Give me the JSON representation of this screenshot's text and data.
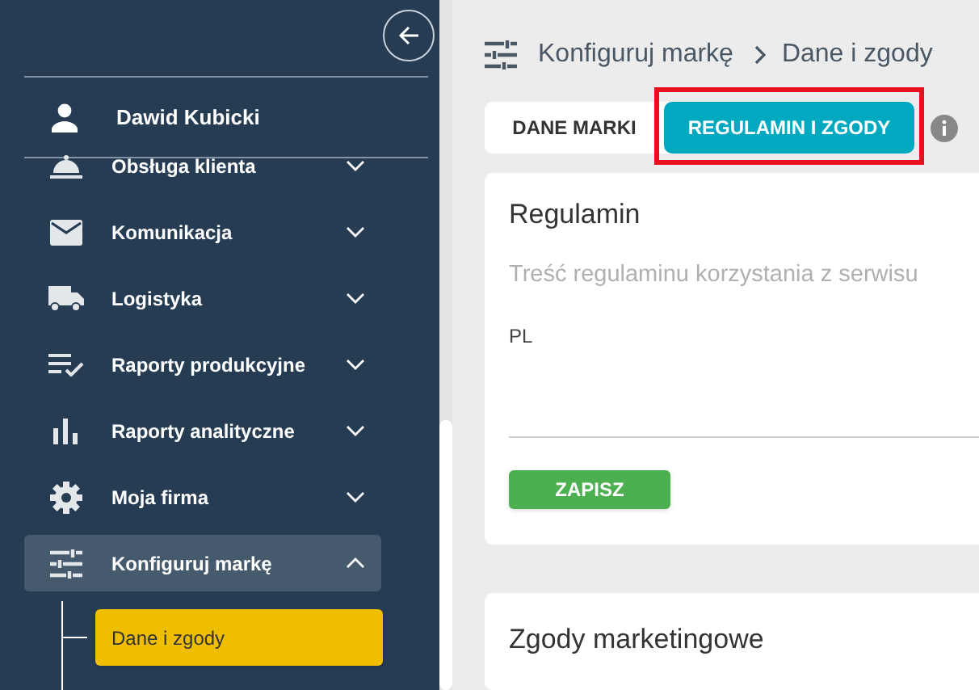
{
  "sidebar": {
    "user": {
      "name": "Dawid Kubicki"
    },
    "items": [
      {
        "kind": "bell",
        "label": "Obsługa klienta",
        "expanded": false,
        "selected": false
      },
      {
        "kind": "mail",
        "label": "Komunikacja",
        "expanded": false,
        "selected": false
      },
      {
        "kind": "truck",
        "label": "Logistyka",
        "expanded": false,
        "selected": false
      },
      {
        "kind": "checklist",
        "label": "Raporty produkcyjne",
        "expanded": false,
        "selected": false
      },
      {
        "kind": "bars",
        "label": "Raporty analityczne",
        "expanded": false,
        "selected": false
      },
      {
        "kind": "gear",
        "label": "Moja firma",
        "expanded": false,
        "selected": false
      },
      {
        "kind": "sliders",
        "label": "Konfiguruj markę",
        "expanded": true,
        "selected": true,
        "children": [
          {
            "label": "Dane i zgody",
            "selected": true
          }
        ]
      }
    ]
  },
  "breadcrumb": [
    "Konfiguruj markę",
    "Dane i zgody"
  ],
  "tabs": [
    {
      "label": "DANE MARKI",
      "selected": false,
      "highlighted": false
    },
    {
      "label": "REGULAMIN I ZGODY",
      "selected": true,
      "highlighted": true
    }
  ],
  "terms_card": {
    "title": "Regulamin",
    "placeholder": "Treść regulaminu korzystania z serwisu",
    "language": "PL",
    "button": "ZAPISZ"
  },
  "consents_card": {
    "title": "Zgody marketingowe"
  }
}
